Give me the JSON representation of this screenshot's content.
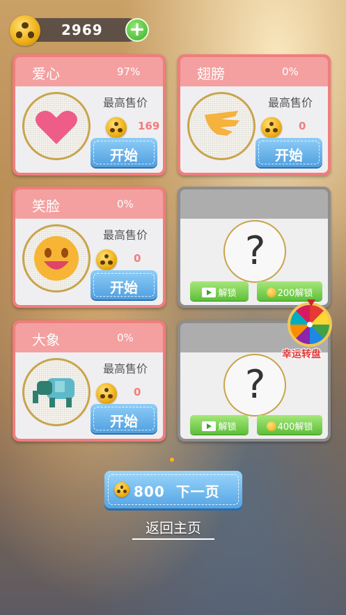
{
  "header": {
    "coins": "2969"
  },
  "cards": [
    {
      "name": "爱心",
      "percent": "97%",
      "max_label": "最高售价",
      "price": "169",
      "button": "开始",
      "icon": "heart"
    },
    {
      "name": "翅膀",
      "percent": "0%",
      "max_label": "最高售价",
      "price": "0",
      "button": "开始",
      "icon": "wing"
    },
    {
      "name": "笑脸",
      "percent": "0%",
      "max_label": "最高售价",
      "price": "0",
      "button": "开始",
      "icon": "smiley"
    },
    {
      "name": "大象",
      "percent": "0%",
      "max_label": "最高售价",
      "price": "0",
      "button": "开始",
      "icon": "elephant"
    }
  ],
  "locked": [
    {
      "symbol": "?",
      "video_unlock": "解锁",
      "coin_unlock": "200解锁"
    },
    {
      "symbol": "?",
      "video_unlock": "解锁",
      "coin_unlock": "400解锁"
    }
  ],
  "wheel": {
    "label": "幸运转盘"
  },
  "footer": {
    "next_cost": "800",
    "next_label": "下一页",
    "home_label": "返回主页"
  },
  "colors": {
    "card": "#f07d7d",
    "button_blue": "#54a4e5",
    "unlock_green": "#5dbf39",
    "coin": "#f0b21a"
  }
}
